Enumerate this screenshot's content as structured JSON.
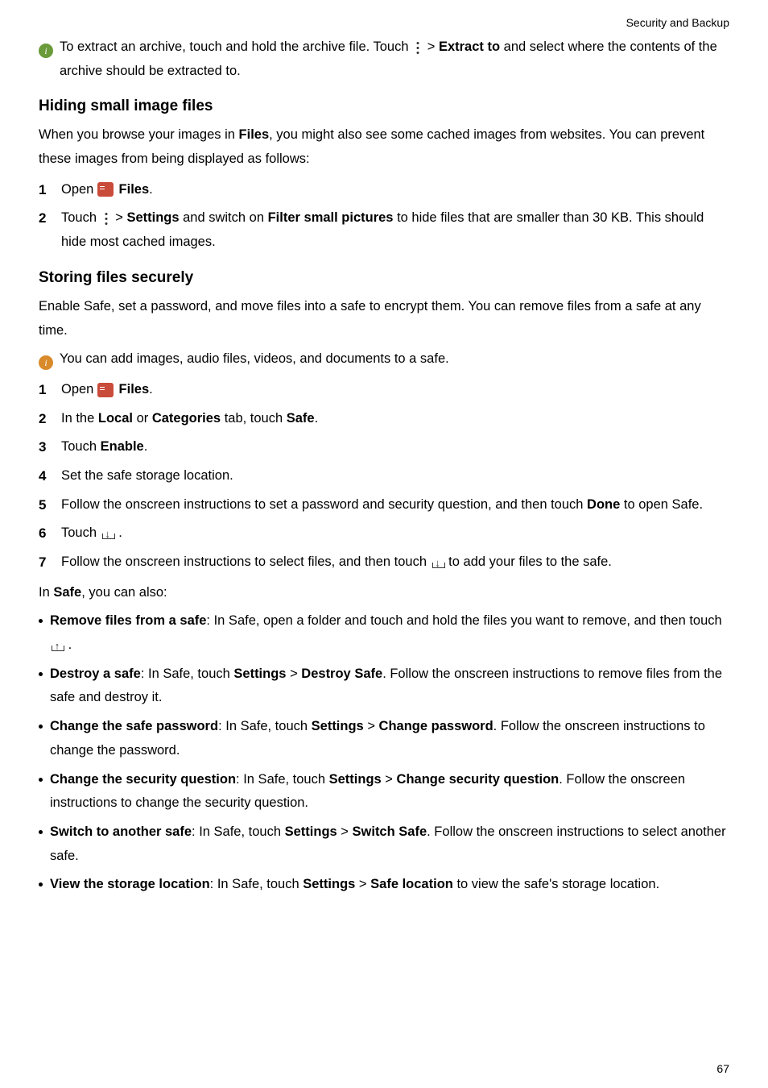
{
  "header": {
    "section": "Security and Backup"
  },
  "tip_extract": {
    "text_a": "To extract an archive, touch and hold the archive file. Touch ",
    "text_b": " > ",
    "bold_b": "Extract to",
    "text_c": " and select where the contents of the archive should be extracted to."
  },
  "h_hiding": "Hiding small image files",
  "p_hiding_intro_a": "When you browse your images in ",
  "p_hiding_intro_b": "Files",
  "p_hiding_intro_c": ", you might also see some cached images from websites. You can prevent these images from being displayed as follows:",
  "hiding_steps": {
    "s1_a": "Open ",
    "s1_b": "Files",
    "s1_c": ".",
    "s2_a": "Touch ",
    "s2_b": " > ",
    "s2_c": "Settings",
    "s2_d": " and switch on ",
    "s2_e": "Filter small pictures",
    "s2_f": " to hide files that are smaller than 30 KB. This should hide most cached images."
  },
  "h_storing": "Storing files securely",
  "p_storing_intro": "Enable Safe, set a password, and move files into a safe to encrypt them. You can remove files from a safe at any time.",
  "tip_safe": "You can add images, audio files, videos, and documents to a safe.",
  "storing_steps": {
    "s1_a": "Open ",
    "s1_b": "Files",
    "s1_c": ".",
    "s2_a": "In the ",
    "s2_b": "Local",
    "s2_c": " or ",
    "s2_d": "Categories",
    "s2_e": " tab, touch ",
    "s2_f": "Safe",
    "s2_g": ".",
    "s3_a": "Touch ",
    "s3_b": "Enable",
    "s3_c": ".",
    "s4": "Set the safe storage location.",
    "s5_a": "Follow the onscreen instructions to set a password and security question, and then touch ",
    "s5_b": "Done",
    "s5_c": " to open Safe.",
    "s6_a": "Touch ",
    "s6_b": " .",
    "s7_a": "Follow the onscreen instructions to select files, and then touch ",
    "s7_b": " to add your files to the safe."
  },
  "p_insafe_a": "In ",
  "p_insafe_b": "Safe",
  "p_insafe_c": ", you can also:",
  "bullets": {
    "b1_a": "Remove files from a safe",
    "b1_b": ": In Safe, open a folder and touch and hold the files you want to remove, and then touch ",
    "b1_c": " .",
    "b2_a": "Destroy a safe",
    "b2_b": ": In Safe, touch ",
    "b2_c": "Settings",
    "b2_d": " > ",
    "b2_e": "Destroy Safe",
    "b2_f": ". Follow the onscreen instructions to remove files from the safe and destroy it.",
    "b3_a": "Change the safe password",
    "b3_b": ": In Safe, touch ",
    "b3_c": "Settings",
    "b3_d": " > ",
    "b3_e": "Change password",
    "b3_f": ". Follow the onscreen instructions to change the password.",
    "b4_a": "Change the security question",
    "b4_b": ": In Safe, touch ",
    "b4_c": "Settings",
    "b4_d": " > ",
    "b4_e": "Change security question",
    "b4_f": ". Follow the onscreen instructions to change the security question.",
    "b5_a": "Switch to another safe",
    "b5_b": ": In Safe, touch ",
    "b5_c": "Settings",
    "b5_d": " > ",
    "b5_e": "Switch Safe",
    "b5_f": ". Follow the onscreen instructions to select another safe.",
    "b6_a": "View the storage location",
    "b6_b": ": In Safe, touch ",
    "b6_c": "Settings",
    "b6_d": " > ",
    "b6_e": "Safe location",
    "b6_f": " to view the safe's storage location."
  },
  "page_num": "67"
}
